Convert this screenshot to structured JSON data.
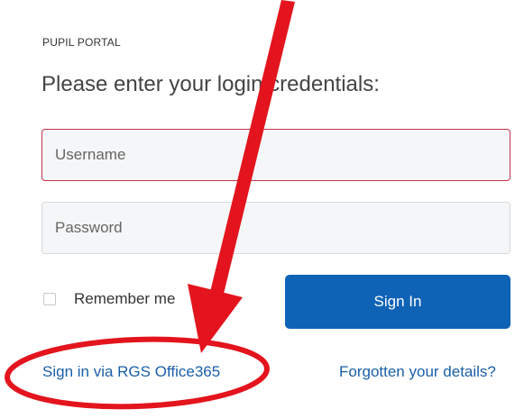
{
  "portal": {
    "label": "PUPIL PORTAL",
    "heading": "Please enter your login credentials:"
  },
  "form": {
    "username_placeholder": "Username",
    "password_placeholder": "Password",
    "remember_label": "Remember me",
    "signin_label": "Sign In"
  },
  "links": {
    "office365": "Sign in via RGS Office365",
    "forgot": "Forgotten your details?"
  },
  "colors": {
    "primary": "#0f63b6",
    "link": "#1a5fa8",
    "error_border": "#c2334d",
    "annotation": "#e3141d"
  }
}
